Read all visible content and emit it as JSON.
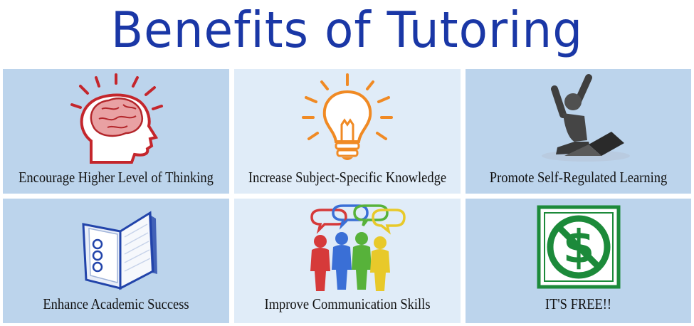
{
  "title": "Benefits of Tutoring",
  "colors": {
    "title": "#1a37a6",
    "tile_dark": "#bcd4ec",
    "tile_light": "#e0ecf8"
  },
  "tiles": [
    {
      "caption": "Encourage Higher Level of Thinking",
      "icon": "brain-head-icon"
    },
    {
      "caption": "Increase Subject-Specific Knowledge",
      "icon": "lightbulb-icon"
    },
    {
      "caption": "Promote Self-Regulated Learning",
      "icon": "person-laptop-icon"
    },
    {
      "caption": "Enhance Academic Success",
      "icon": "notebook-icon"
    },
    {
      "caption": "Improve Communication Skills",
      "icon": "people-speech-icon"
    },
    {
      "caption": "IT'S FREE!!",
      "icon": "no-dollar-icon"
    }
  ]
}
